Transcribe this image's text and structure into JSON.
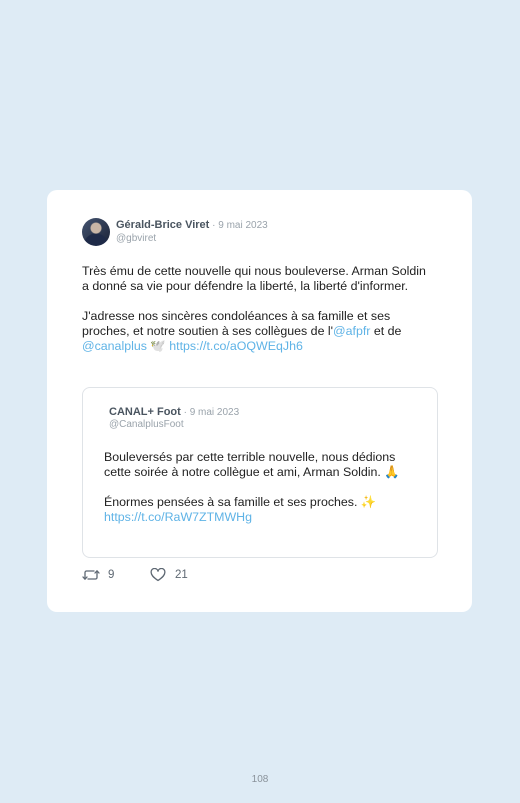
{
  "tweet": {
    "author_name": "Gérald-Brice Viret",
    "separator": " · ",
    "date": "9 mai 2023",
    "handle": "@gbviret",
    "para1": "Très ému de cette nouvelle qui nous bouleverse. Arman Soldin a donné sa vie pour défendre la liberté, la liberté d'informer.",
    "para2_prefix": "J'adresse nos sincères condoléances à sa famille et ses proches, et notre soutien à ses collègues de l'",
    "mention1": "@afpfr",
    "para2_mid": " et de ",
    "mention2": "@canalplus",
    "emoji": " 🕊️ ",
    "link": "https://t.co/aOQWEqJh6"
  },
  "quoted": {
    "author_name": "CANAL+ Foot",
    "separator": " · ",
    "date": "9 mai 2023",
    "handle": "@CanalplusFoot",
    "para1": "Bouleversés par cette terrible nouvelle, nous dédions cette soirée à notre collègue et ami, Arman Soldin. 🙏",
    "para2": "Énormes pensées à sa famille et ses proches. ✨",
    "link": "https://t.co/RaW7ZTMWHg"
  },
  "actions": {
    "retweets": "9",
    "likes": "21"
  },
  "page_number": "108",
  "colors": {
    "background": "#deebf5",
    "link": "#5fb3e6",
    "card": "#ffffff"
  },
  "icons": [
    "avatar",
    "retweet-icon",
    "like-icon"
  ]
}
